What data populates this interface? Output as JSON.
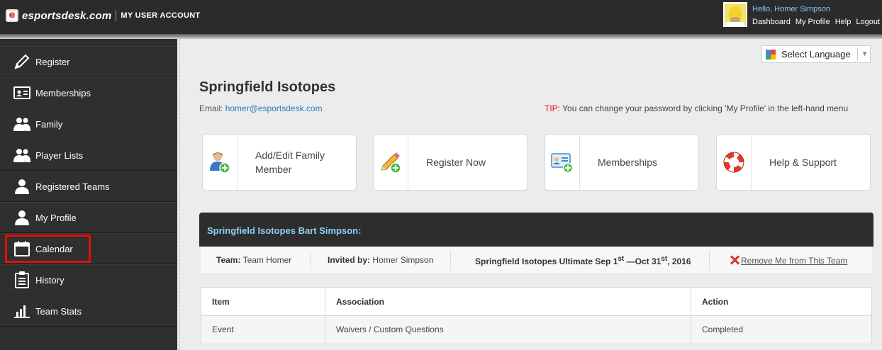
{
  "header": {
    "logo_text": "esportsdesk.com",
    "section_title": "MY USER ACCOUNT",
    "greeting": "Hello, Homer Simpson",
    "links": [
      "Dashboard",
      "My Profile",
      "Help",
      "Logout"
    ]
  },
  "sidebar": {
    "items": [
      {
        "label": "Register",
        "icon": "pencil-icon"
      },
      {
        "label": "Memberships",
        "icon": "id-card-icon"
      },
      {
        "label": "Family",
        "icon": "users-icon"
      },
      {
        "label": "Player Lists",
        "icon": "users-icon"
      },
      {
        "label": "Registered Teams",
        "icon": "user-icon"
      },
      {
        "label": "My Profile",
        "icon": "user-icon"
      },
      {
        "label": "Calendar",
        "icon": "calendar-icon"
      },
      {
        "label": "History",
        "icon": "clipboard-icon"
      },
      {
        "label": "Team Stats",
        "icon": "bar-chart-icon"
      }
    ],
    "highlighted": "Calendar"
  },
  "language": {
    "label": "Select Language"
  },
  "main": {
    "title": "Springfield Isotopes",
    "email_label": "Email:",
    "email": "homer@esportsdesk.com",
    "tip_label": "TIP:",
    "tip_text": " You can change your password by clicking 'My Profile' in the left-hand menu"
  },
  "cards": [
    {
      "label": "Add/Edit Family Member",
      "icon": "add-member-icon"
    },
    {
      "label": "Register Now",
      "icon": "register-pencil-icon"
    },
    {
      "label": "Memberships",
      "icon": "membership-card-icon"
    },
    {
      "label": "Help & Support",
      "icon": "lifebuoy-icon"
    }
  ],
  "team_panel": {
    "title": "Springfield Isotopes Bart Simpson:",
    "team_label": "Team:",
    "team_value": " Team Homer",
    "invited_label": "Invited by:",
    "invited_value": " Homer Simpson",
    "season_text": "Springfield Isotopes Ultimate Sep 1",
    "season_sup1": "st",
    "season_mid": " —Oct 31",
    "season_sup2": "st",
    "season_end": ", 2016",
    "remove_label": "Remove Me from This Team",
    "table": {
      "headers": [
        "Item",
        "Association",
        "Action"
      ],
      "rows": [
        [
          "Event",
          "Waivers / Custom Questions",
          "Completed"
        ]
      ]
    }
  },
  "colors": {
    "topbar": "#2b2b2b",
    "sidebar": "#2f2f2f",
    "link_blue": "#2a7db5",
    "highlight_red": "#e01010",
    "team_title": "#8fd0f5"
  }
}
